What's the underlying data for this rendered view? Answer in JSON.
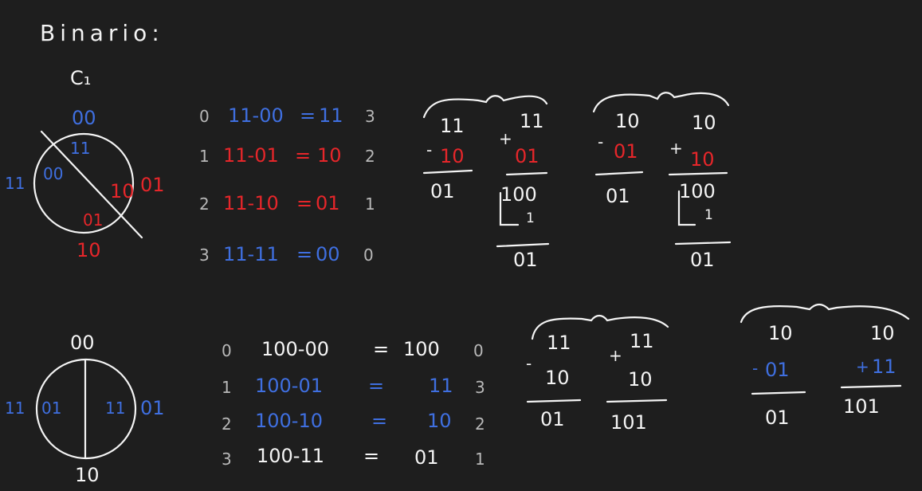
{
  "title": "Binario:",
  "subtitle": "C₁",
  "colors": {
    "background": "#1e1e1e",
    "white": "#f4f4f4",
    "blue": "#3f6fe0",
    "red": "#e6262a",
    "grey": "#b8b8b8"
  },
  "circle1": {
    "top": "00",
    "left": "11",
    "right": "01",
    "bottom": "10",
    "inner_top": "11",
    "inner_left": "00",
    "inner_right": "10",
    "inner_bottom": "01"
  },
  "circle2": {
    "top": "00",
    "left": "11",
    "right": "01",
    "bottom": "10",
    "inner_left": "01",
    "inner_right": "11"
  },
  "c1_rows": [
    {
      "n": "0",
      "expr_a": "11-00",
      "eq": "=",
      "res": "11",
      "k": "3"
    },
    {
      "n": "1",
      "expr_a": "11-01",
      "eq": "=",
      "res": "10",
      "k": "2"
    },
    {
      "n": "2",
      "expr_a": "11-10",
      "eq": "=",
      "res": "01",
      "k": "1"
    },
    {
      "n": "3",
      "expr_a": "11-11",
      "eq": "=",
      "res": "00",
      "k": "0"
    }
  ],
  "c2_rows": [
    {
      "n": "0",
      "expr_a": "100-00",
      "eq": "=",
      "res": "100",
      "k": "0"
    },
    {
      "n": "1",
      "expr_a": "100-01",
      "eq": "=",
      "res": "11",
      "k": "3"
    },
    {
      "n": "2",
      "expr_a": "100-10",
      "eq": "=",
      "res": "10",
      "k": "2"
    },
    {
      "n": "3",
      "expr_a": "100-11",
      "eq": "=",
      "res": "01",
      "k": "1"
    }
  ],
  "ops_top_a": {
    "sub_top": "11",
    "sub_mid": "10",
    "sub_res": "01",
    "add_top": "11",
    "add_mid": "01",
    "add_res": "100",
    "carry": "1",
    "add_final": "01"
  },
  "ops_top_b": {
    "sub_top": "10",
    "sub_mid": "01",
    "sub_res": "01",
    "add_top": "10",
    "add_mid": "10",
    "add_res": "100",
    "carry": "1",
    "add_final": "01"
  },
  "ops_bot_a": {
    "sub_top": "11",
    "sub_mid": "10",
    "sub_res": "01",
    "add_top": "11",
    "add_mid": "10",
    "add_res": "101"
  },
  "ops_bot_b": {
    "sub_top": "10",
    "sub_mid": "01",
    "sub_res": "01",
    "add_top": "10",
    "add_mid": "11",
    "add_res": "101"
  }
}
